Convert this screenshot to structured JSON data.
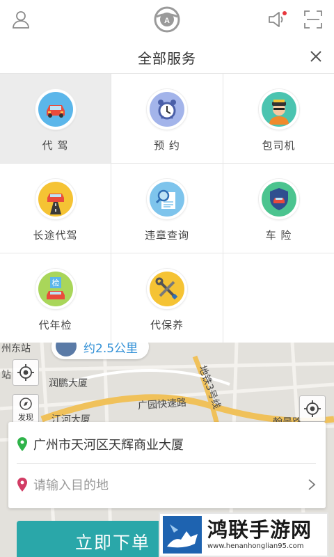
{
  "header": {
    "icons": [
      "user-icon",
      "steering-wheel-logo",
      "speaker-icon",
      "scan-icon"
    ]
  },
  "panel": {
    "title": "全部服务",
    "close_icon": "close-icon"
  },
  "services": [
    {
      "label": "代 驾",
      "icon": "car-icon",
      "color": "#5bb6ea",
      "active": true
    },
    {
      "label": "预 约",
      "icon": "alarm-clock-icon",
      "color": "#a3b4ea",
      "active": false
    },
    {
      "label": "包司机",
      "icon": "chauffeur-icon",
      "color": "#4bc4b0",
      "active": false
    },
    {
      "label": "长途代驾",
      "icon": "road-car-icon",
      "color": "#f5c334",
      "active": false
    },
    {
      "label": "违章查询",
      "icon": "magnifier-document-icon",
      "color": "#7ec4ec",
      "active": false
    },
    {
      "label": "车 险",
      "icon": "shield-car-icon",
      "color": "#4bc48f",
      "active": false
    },
    {
      "label": "代年检",
      "icon": "inspection-car-icon",
      "color": "#a9d65a",
      "active": false
    },
    {
      "label": "代保养",
      "icon": "tools-icon",
      "color": "#f5c334",
      "active": false
    }
  ],
  "map": {
    "distance_text": "约2.5公里",
    "labels": [
      "州东站",
      "站",
      "润鹏大厦",
      "江河大厦",
      "广园快速路",
      "地铁3号线",
      "翰景路"
    ],
    "compass_label": "发现"
  },
  "address": {
    "origin": "广州市天河区天辉商业大厦",
    "destination_placeholder": "请输入目的地"
  },
  "order_button": "立即下单",
  "watermark": {
    "title": "鸿联手游网",
    "url": "www.henanhonglian95.com"
  },
  "colors": {
    "accent": "#2aa7a9",
    "origin_pin": "#2fb34a",
    "destination_pin": "#d23c64",
    "distance_text": "#2f8fd6"
  }
}
